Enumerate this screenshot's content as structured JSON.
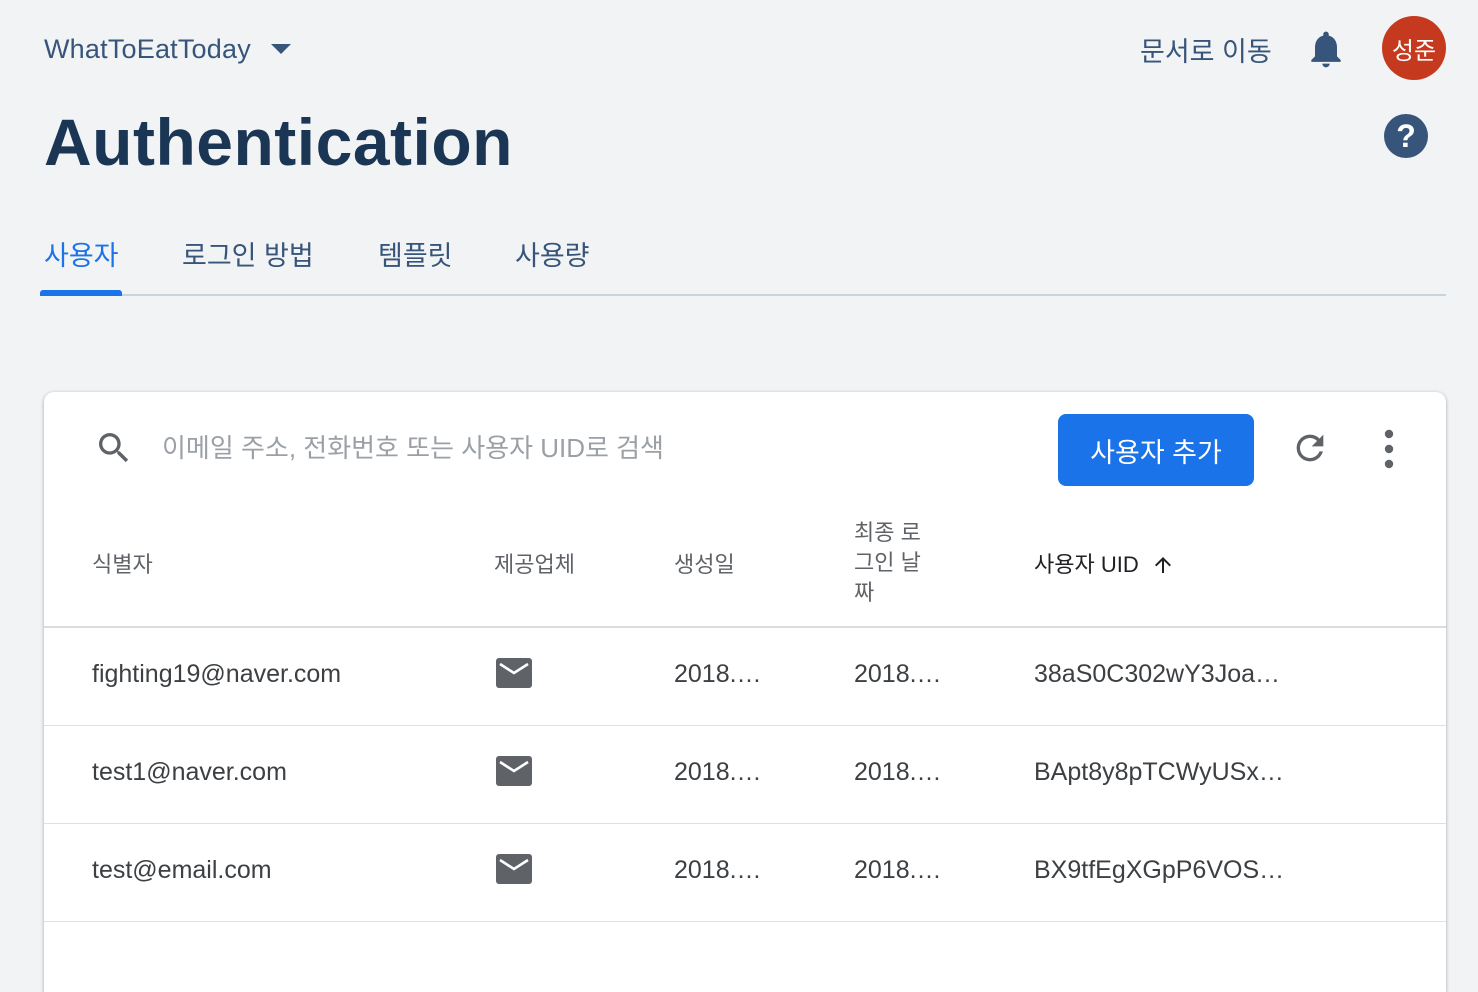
{
  "header": {
    "project_name": "WhatToEatToday",
    "docs_link": "문서로 이동",
    "avatar_text": "성준"
  },
  "page": {
    "title": "Authentication",
    "help_label": "?"
  },
  "tabs": [
    {
      "label": "사용자",
      "active": true
    },
    {
      "label": "로그인 방법",
      "active": false
    },
    {
      "label": "템플릿",
      "active": false
    },
    {
      "label": "사용량",
      "active": false
    }
  ],
  "toolbar": {
    "search_placeholder": "이메일 주소, 전화번호 또는 사용자 UID로 검색",
    "add_user_label": "사용자 추가"
  },
  "table": {
    "columns": {
      "identifier": "식별자",
      "provider": "제공업체",
      "created": "생성일",
      "last_login": [
        "최종 로",
        "그인 날",
        "짜"
      ],
      "uid": "사용자 UID"
    },
    "sort": {
      "column": "uid",
      "direction": "ascending"
    },
    "rows": [
      {
        "identifier": "fighting19@naver.com",
        "provider": "email",
        "created": "2018.…",
        "last_login": "2018.…",
        "uid": "38aS0C302wY3Joa…"
      },
      {
        "identifier": "test1@naver.com",
        "provider": "email",
        "created": "2018.…",
        "last_login": "2018.…",
        "uid": "BApt8y8pTCWyUSx…"
      },
      {
        "identifier": "test@email.com",
        "provider": "email",
        "created": "2018.…",
        "last_login": "2018.…",
        "uid": "BX9tfEgXGpP6VOS…"
      }
    ]
  },
  "colors": {
    "accent": "#1a73e8",
    "navy_text": "#37557a",
    "title": "#1b3654",
    "avatar_bg": "#c5391f"
  }
}
